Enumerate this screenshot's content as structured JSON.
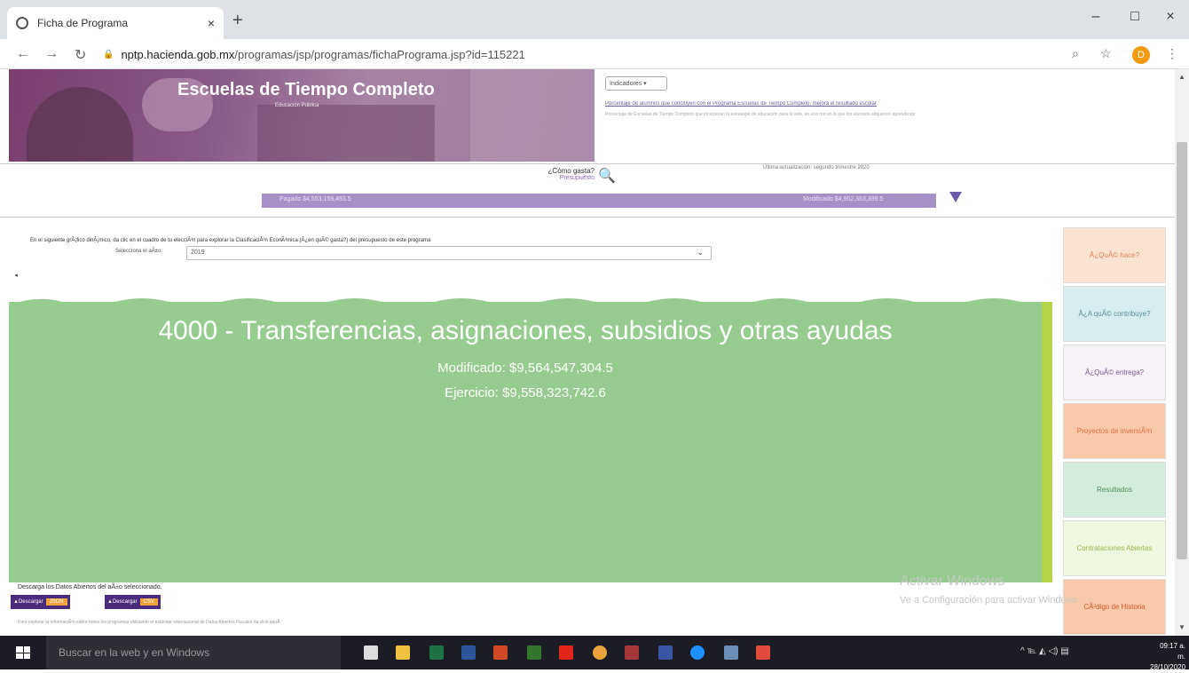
{
  "browser": {
    "tab_title": "Ficha de Programa",
    "tab_close": "×",
    "new_tab": "+",
    "url_domain": "nptp.hacienda.gob.mx",
    "url_path": "/programas/jsp/programas/fichaPrograma.jsp?id=115221",
    "win_min": "–",
    "win_max": "□",
    "win_close": "×",
    "profile_initial": "D"
  },
  "header": {
    "program_title": "Escuelas de Tiempo Completo",
    "program_subtitle": "Educación Pública",
    "indicators_button": "Indicadores ▾",
    "indicators_link": "Porcentaje de alumnos que concluyen con el Programa Escuelas de Tiempo Completo, mejora el resultado escolar",
    "indicators_note": "Porcentaje de Escuelas de Tiempo Completo que incorporan la estrategia de educación para la vida, en una red en la que los alumnos adquieren aprendizaje"
  },
  "filters": {
    "question": "¿Cómo gasta?",
    "question_sub": "Presupuesto",
    "last_update": "Última actualización: segundo trimestre 2020",
    "bar_left": "Pagado $4,553,159,493.5",
    "bar_right": "Modificado $4,952,353,399.5"
  },
  "chart_section": {
    "instructions": "En el siguiente grÃ¡fico dinÃ¡mico, da clic en el cuadro de tu elecciÃ³n para explorar la ClasificaciÃ³n EconÃ³mica (Â¿en quÃ© gasta?) del presupuesto de este programa",
    "year_label": "Selecciona el aÃ±o:",
    "year_value": "2019",
    "back": "◂"
  },
  "treemap": {
    "title": "4000 - Transferencias, asignaciones, subsidios y otras ayudas",
    "modificado": "Modificado: $9,564,547,304.5",
    "ejercicio": "Ejercicio: $9,558,323,742.6",
    "colors": {
      "main": "#97cc90",
      "strip": "#b5d44a"
    }
  },
  "sidebar": [
    {
      "label": "Â¿QuÃ© hace?",
      "bg": "#fbe3d3",
      "color": "#e0865a"
    },
    {
      "label": "Â¿A quÃ© contribuye?",
      "bg": "#d8edf0",
      "color": "#5a8d94"
    },
    {
      "label": "Â¿QuÃ© entrega?",
      "bg": "#f5f1f7",
      "color": "#7a5a8e"
    },
    {
      "label": "Proyectos de inversiÃ³n",
      "bg": "#f8c9a8",
      "color": "#e07040"
    },
    {
      "label": "Resultados",
      "bg": "#d3ecdc",
      "color": "#4d8e5a"
    },
    {
      "label": "Contrataciones Abiertas",
      "bg": "#eef7e0",
      "color": "#9ab84a"
    },
    {
      "label": "CÃ³digo de Historia",
      "bg": "#f8c9a8",
      "color": "#d45a30"
    }
  ],
  "downloads": {
    "label": "Descarga los Datos Abiertos del aÃ±o seleccionado.",
    "btn1": "Descargar",
    "btn1_fmt": "JSON",
    "btn2": "Descargar",
    "btn2_fmt": "CSV",
    "note": "Para explorar la informaciÃ³n sobre todos los programas utilizando el estándar internacional de Datos Abiertos Fiscales da click aquÃ"
  },
  "watermark": {
    "line1": "Activar Windows",
    "line2": "Ve a Configuración para activar Windows."
  },
  "taskbar": {
    "search": "Buscar en la web y en Windows",
    "tray": "^  ℡  ◭  ◁)  ▤",
    "time": "09:17 a. m.",
    "date": "28/10/2020"
  }
}
